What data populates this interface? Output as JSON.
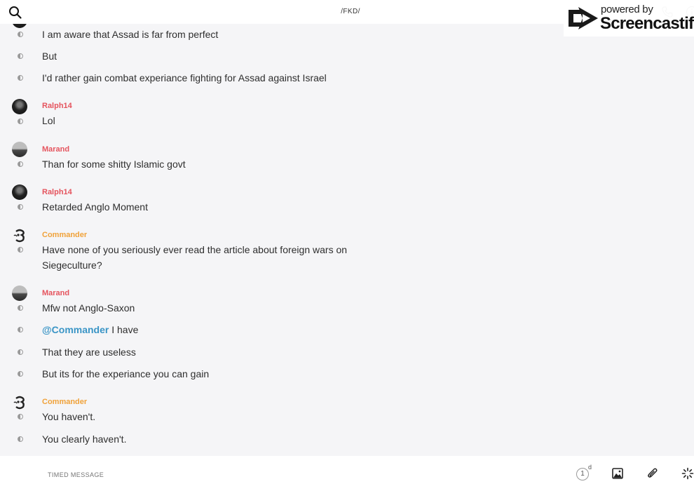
{
  "header": {
    "title": "/FKD/"
  },
  "watermark": {
    "powered": "powered by",
    "brand": "Screencastify"
  },
  "messages": [
    {
      "text": "I am aware that Assad is far from perfect"
    },
    {
      "text": "But"
    },
    {
      "text": "I'd rather gain combat experiance fighting for Assad against Israel"
    },
    {
      "user": "Ralph14",
      "text": "Lol"
    },
    {
      "user": "Marand",
      "text": "Than for some shitty Islamic govt"
    },
    {
      "user": "Ralph14",
      "text": "Retarded Anglo Moment"
    },
    {
      "user": "Commander",
      "text": "Have none of you seriously ever read the article about foreign wars on Siegeculture?"
    },
    {
      "user": "Marand",
      "text": "Mfw not Anglo-Saxon"
    },
    {
      "mention": "@Commander",
      "text": " I have"
    },
    {
      "text": "That they are useless"
    },
    {
      "text": "But its for the experiance you can gain"
    },
    {
      "user": "Commander",
      "text": "You haven't."
    },
    {
      "text": "You clearly haven't."
    }
  ],
  "composer": {
    "placeholder": "TIMED MESSAGE",
    "timer_value": "1",
    "timer_unit": "d"
  },
  "colors": {
    "username_red": "#e5545e",
    "username_orange": "#f0a23a",
    "mention_blue": "#3a95c6",
    "background": "#f5f5f7"
  },
  "icons": [
    "search-icon",
    "phone-icon",
    "info-icon",
    "message-status-icon",
    "timer-icon",
    "image-icon",
    "paperclip-icon",
    "sparkle-icon"
  ]
}
